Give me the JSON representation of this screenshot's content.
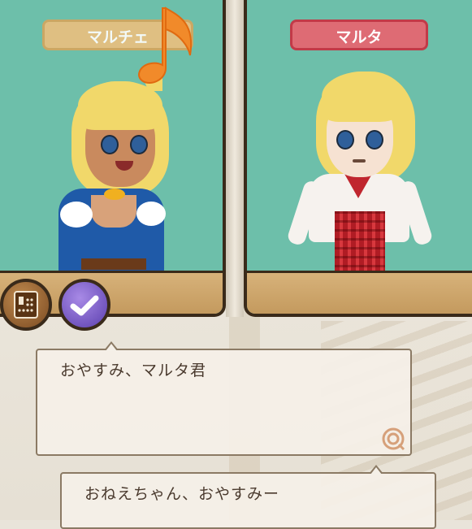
{
  "speakers": {
    "left": {
      "name": "マルチェ"
    },
    "right": {
      "name": "マルタ"
    }
  },
  "dialog": [
    {
      "text": "おやすみ、マルタ君"
    },
    {
      "text": "おねえちゃん、おやすみー"
    }
  ],
  "icons": {
    "music": "music-note-icon",
    "memo": "memo-icon",
    "check": "checkmark-icon",
    "next": "next-arrow-icon"
  },
  "colors": {
    "panel_bg": "#6dbfaa",
    "active_tag": "#de6b74",
    "inactive_tag": "#e9c07f",
    "frame": "#3a2a1a"
  }
}
